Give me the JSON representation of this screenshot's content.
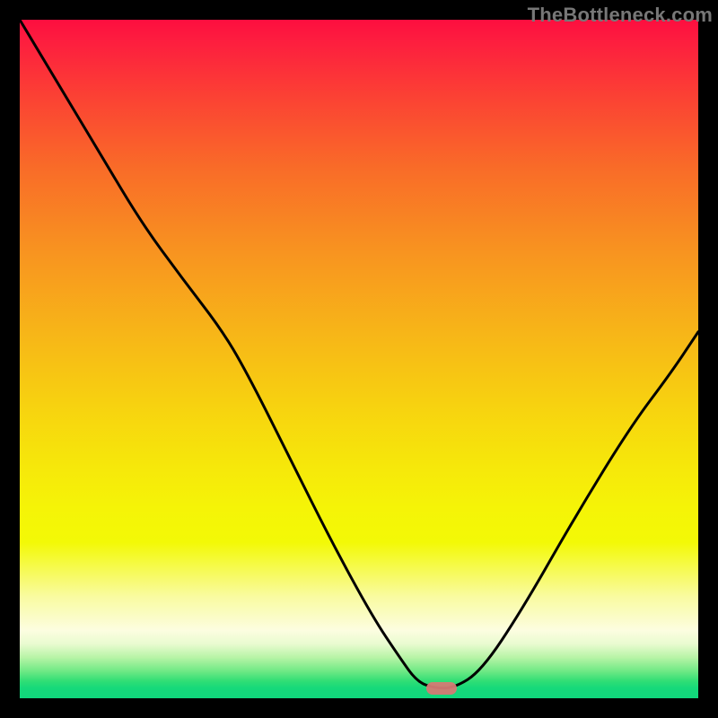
{
  "watermark": "TheBottleneck.com",
  "marker": {
    "x_frac": 0.622,
    "y_frac": 0.985,
    "color": "#d47a74"
  },
  "chart_data": {
    "type": "line",
    "title": "",
    "xlabel": "",
    "ylabel": "",
    "xlim": [
      0,
      1
    ],
    "ylim": [
      0,
      1
    ],
    "grid": false,
    "legend": null,
    "series": [
      {
        "name": "bottleneck-curve",
        "x": [
          0.0,
          0.06,
          0.12,
          0.18,
          0.24,
          0.3,
          0.34,
          0.4,
          0.46,
          0.52,
          0.56,
          0.585,
          0.61,
          0.64,
          0.68,
          0.74,
          0.82,
          0.9,
          0.96,
          1.0
        ],
        "y": [
          1.0,
          0.9,
          0.8,
          0.7,
          0.618,
          0.54,
          0.47,
          0.35,
          0.23,
          0.12,
          0.06,
          0.025,
          0.015,
          0.015,
          0.04,
          0.13,
          0.27,
          0.4,
          0.48,
          0.54
        ],
        "color": "#000000",
        "linewidth": 3
      }
    ],
    "marker_point": {
      "x": 0.622,
      "y": 0.015
    },
    "background_gradient": {
      "direction": "vertical",
      "stops": [
        {
          "pos": 0.0,
          "color": "#fd0e3f"
        },
        {
          "pos": 0.34,
          "color": "#f89320"
        },
        {
          "pos": 0.66,
          "color": "#f6e80a"
        },
        {
          "pos": 0.9,
          "color": "#fcfde0"
        },
        {
          "pos": 1.0,
          "color": "#10d77c"
        }
      ]
    }
  }
}
